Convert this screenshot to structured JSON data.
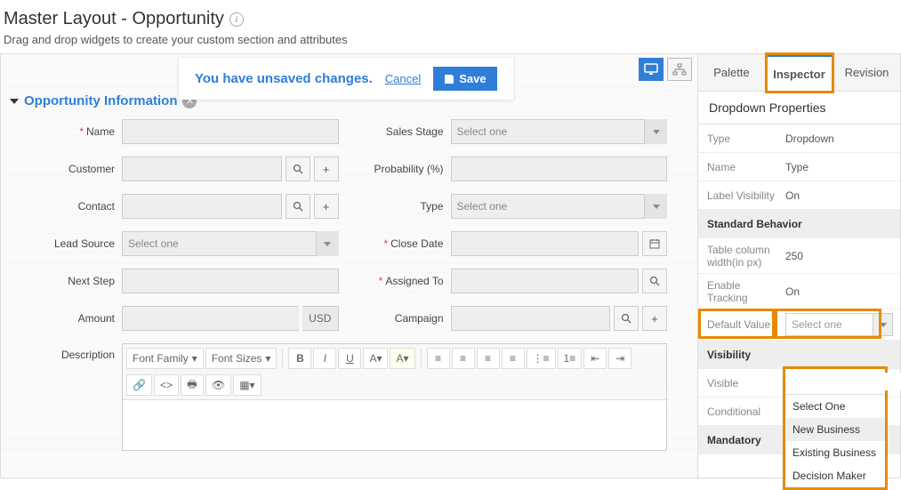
{
  "header": {
    "title": "Master Layout - Opportunity",
    "subtitle": "Drag and drop widgets to create your custom section and attributes"
  },
  "unsaved": {
    "message": "You have unsaved changes.",
    "cancel": "Cancel",
    "save": "Save"
  },
  "section": {
    "title": "Opportunity Information"
  },
  "fields": {
    "name": "Name",
    "customer": "Customer",
    "contact": "Contact",
    "lead_source": "Lead Source",
    "next_step": "Next Step",
    "amount": "Amount",
    "description": "Description",
    "amount_suffix": "USD",
    "sales_stage": "Sales Stage",
    "probability": "Probability (%)",
    "type": "Type",
    "close_date": "Close Date",
    "assigned_to": "Assigned To",
    "campaign": "Campaign",
    "select_one": "Select one"
  },
  "rte": {
    "font_family": "Font Family",
    "font_sizes": "Font Sizes"
  },
  "side": {
    "tabs": {
      "palette": "Palette",
      "inspector": "Inspector",
      "revision": "Revision"
    },
    "panel_title": "Dropdown Properties",
    "rows": {
      "type_k": "Type",
      "type_v": "Dropdown",
      "name_k": "Name",
      "name_v": "Type",
      "labelvis_k": "Label Visibility",
      "labelvis_v": "On",
      "std_behavior": "Standard Behavior",
      "colw_k": "Table column width(in px)",
      "colw_v": "250",
      "track_k": "Enable Tracking",
      "track_v": "On",
      "defval_k": "Default Value",
      "defval_ph": "Select one",
      "visibility": "Visibility",
      "visible_k": "Visible",
      "conditional_k": "Conditional",
      "mandatory": "Mandatory"
    }
  },
  "dropdown": {
    "options": [
      "Select One",
      "New Business",
      "Existing Business",
      "Decision Maker"
    ]
  }
}
